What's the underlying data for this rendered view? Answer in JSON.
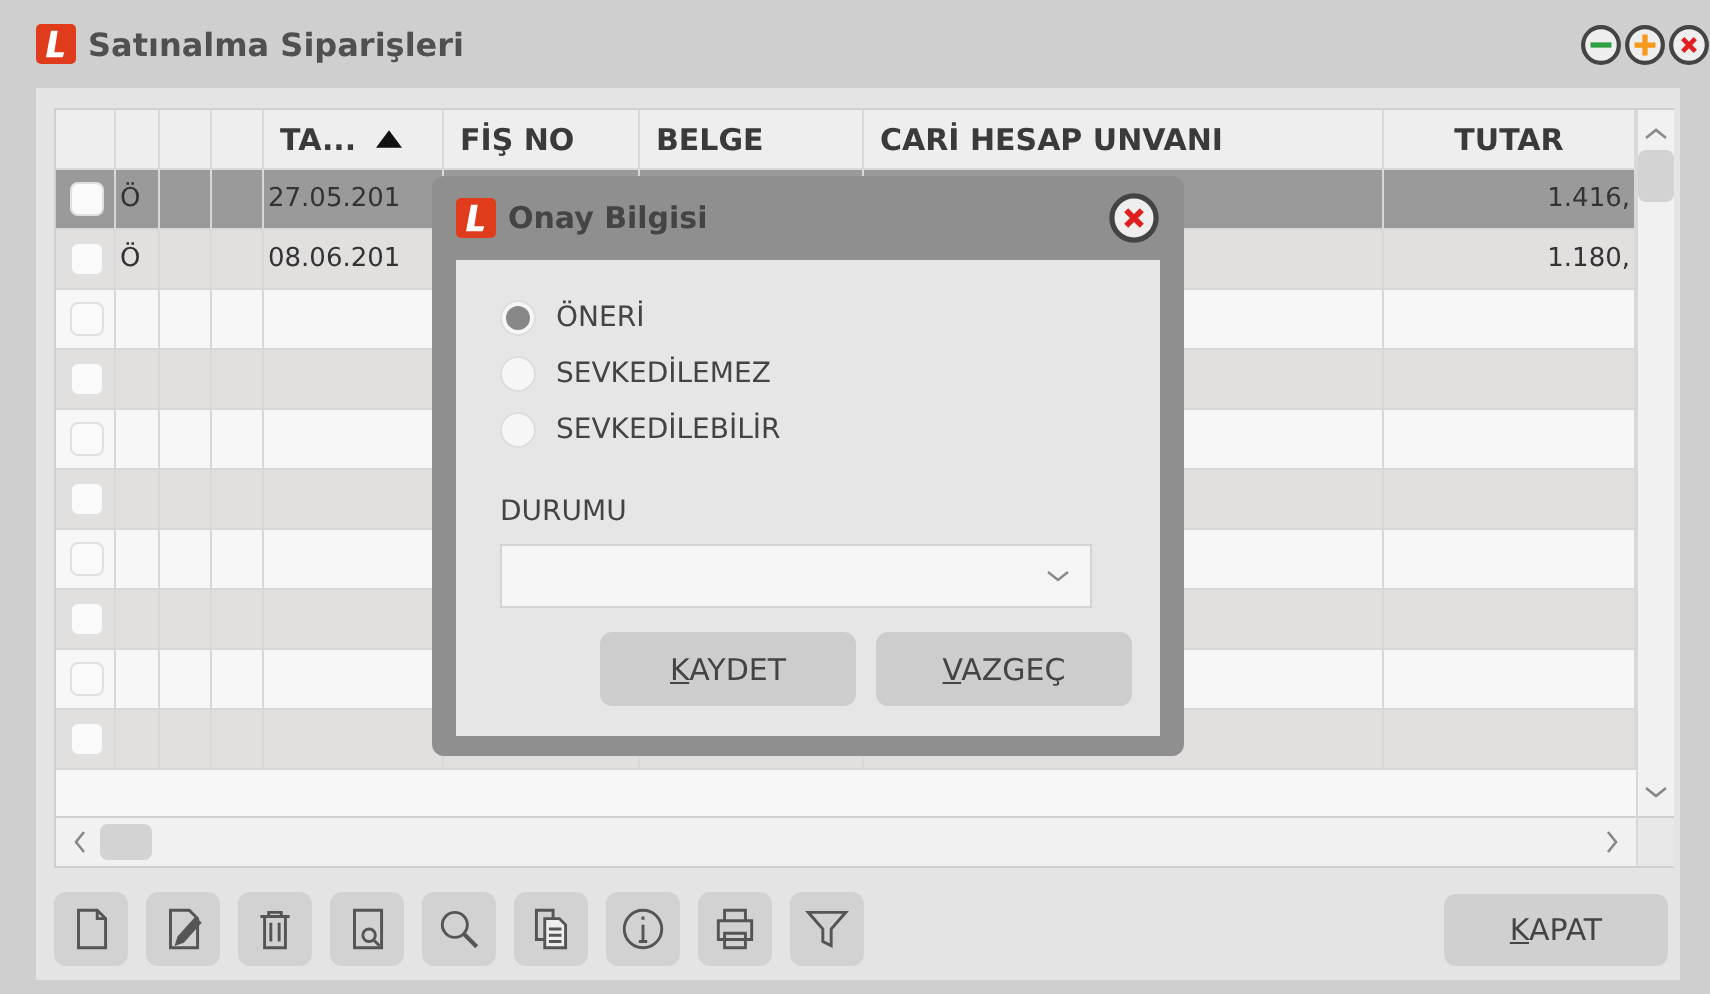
{
  "window": {
    "title": "Satınalma Siparişleri"
  },
  "table": {
    "columns": [
      {
        "label": "TA...",
        "sorted_ascending": true
      },
      {
        "label": "FİŞ NO"
      },
      {
        "label": "BELGE"
      },
      {
        "label": "CARİ HESAP UNVANI"
      },
      {
        "label": "TUTAR"
      }
    ],
    "rows": [
      {
        "selected": true,
        "checked": false,
        "mark": "Ö",
        "date": "27.05.201",
        "amount": "1.416,"
      },
      {
        "selected": false,
        "checked": false,
        "mark": "Ö",
        "date": "08.06.201",
        "amount": "1.180,"
      },
      {
        "selected": false,
        "checked": false
      },
      {
        "selected": false,
        "checked": false
      },
      {
        "selected": false,
        "checked": false
      },
      {
        "selected": false,
        "checked": false
      },
      {
        "selected": false,
        "checked": false
      },
      {
        "selected": false,
        "checked": false
      },
      {
        "selected": false,
        "checked": false
      },
      {
        "selected": false,
        "checked": false
      }
    ]
  },
  "toolbar": [
    {
      "kind": "new"
    },
    {
      "kind": "edit"
    },
    {
      "kind": "delete"
    },
    {
      "kind": "preview"
    },
    {
      "kind": "search"
    },
    {
      "kind": "copy"
    },
    {
      "kind": "info"
    },
    {
      "kind": "print"
    },
    {
      "kind": "filter"
    }
  ],
  "close_button": {
    "label": "KAPAT"
  },
  "dialog": {
    "title": "Onay Bilgisi",
    "options": [
      {
        "label": "ÖNERİ",
        "selected": true
      },
      {
        "label": "SEVKEDİLEMEZ",
        "selected": false
      },
      {
        "label": "SEVKEDİLEBİLİR",
        "selected": false
      }
    ],
    "field_label": "DURUMU",
    "buttons": [
      {
        "label": "KAYDET"
      },
      {
        "label": "VAZGEÇ"
      }
    ]
  }
}
